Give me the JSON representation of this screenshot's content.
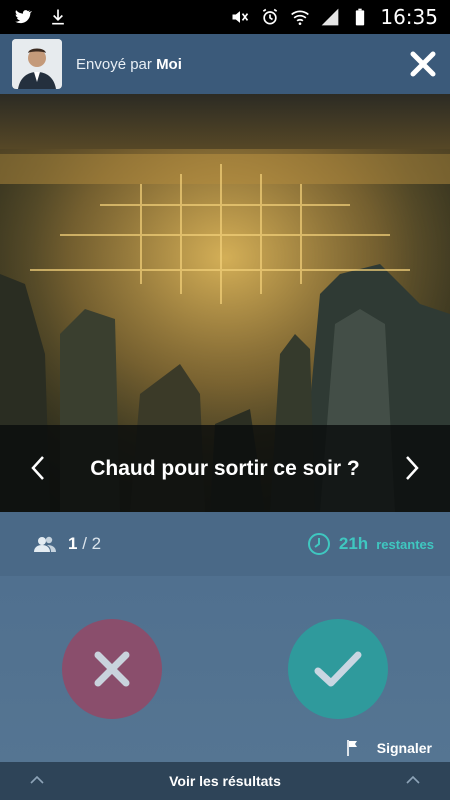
{
  "status_bar": {
    "time": "16:35",
    "icons": [
      "twitter-icon",
      "download-icon",
      "mute-icon",
      "alarm-icon",
      "wifi-icon",
      "signal-icon",
      "battery-icon"
    ]
  },
  "header": {
    "sender_prefix": "Envoyé par",
    "sender_name": "Moi",
    "avatar_icon": "user-avatar",
    "close_icon": "close-icon"
  },
  "photo": {
    "caption": "Chaud pour sortir ce soir ?",
    "prev_icon": "chevron-left-icon",
    "next_icon": "chevron-right-icon"
  },
  "info": {
    "count_current": "1",
    "count_total": "/ 2",
    "timer_hours": "21h",
    "timer_label": "restantes",
    "people_icon": "people-icon",
    "clock_icon": "clock-icon"
  },
  "actions": {
    "decline_icon": "x-icon",
    "accept_icon": "check-icon",
    "report_label": "Signaler",
    "report_icon": "flag-icon"
  },
  "footer": {
    "results_label": "Voir les résultats"
  },
  "colors": {
    "accent": "#3fc7c0",
    "decline": "#8a4e6c",
    "accept": "#2f9a9c",
    "header": "#3b5a7a",
    "footer": "#2e4458"
  }
}
